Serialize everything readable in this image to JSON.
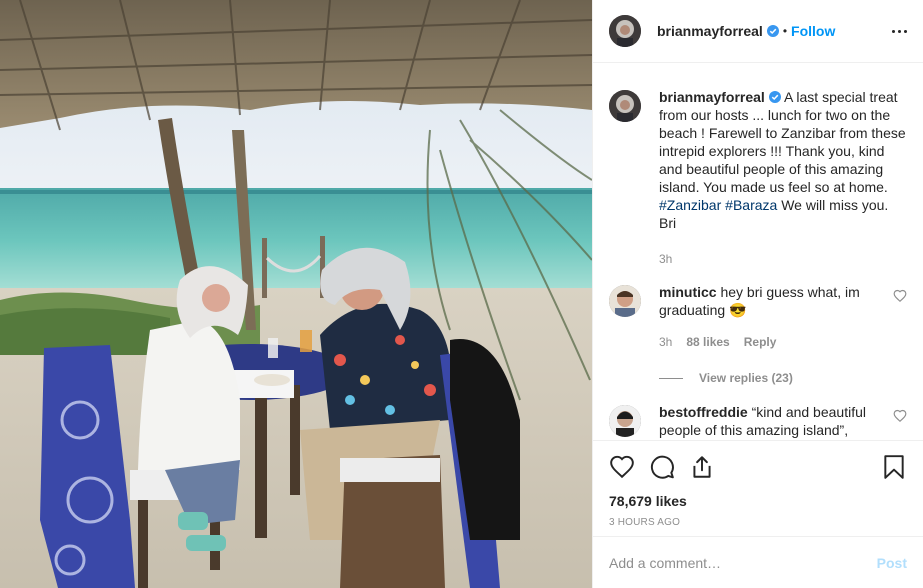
{
  "post": {
    "image_alt": "Two people sitting at a table on the beach under a thatched roof",
    "author": {
      "username": "brianmayforreal",
      "verified": true,
      "follow_label": "Follow",
      "separator": "•"
    },
    "caption": {
      "username": "brianmayforreal",
      "text_1": " A last special treat from our hosts ... lunch for two on the beach ! Farewell to Zanzibar from these intrepid explorers !!! Thank you, kind and beautiful people of this amazing island. You made us feel so at home. ",
      "hashtag_1": "#Zanzibar",
      "hashtag_2": "#Baraza",
      "text_2": " We will miss you. Bri",
      "time": "3h"
    },
    "comments": [
      {
        "username": "minuticc",
        "text": "hey bri guess what, im graduating 😎",
        "time": "3h",
        "likes": "88 likes",
        "reply_label": "Reply",
        "view_replies": "View replies (23)"
      },
      {
        "username": "bestoffreddie",
        "text": "“kind and beautiful people of this amazing island”,"
      }
    ],
    "likes_count": "78,679 likes",
    "time_ago": "3 HOURS AGO",
    "add_comment_placeholder": "Add a comment…",
    "post_label": "Post"
  },
  "icons": {
    "like": "heart-icon",
    "comment": "comment-icon",
    "share": "share-icon",
    "save": "bookmark-icon",
    "more": "more-options-icon",
    "verified": "verified-badge-icon"
  },
  "colors": {
    "link_blue": "#0095f6",
    "post_disabled": "#b2dffc",
    "muted": "#8e8e8e",
    "text": "#262626"
  }
}
